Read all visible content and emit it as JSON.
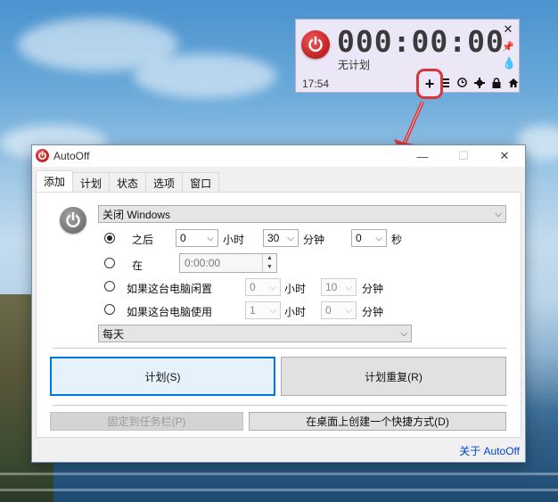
{
  "mini": {
    "countdown": "000:00:00",
    "plan_status": "无计划",
    "clock": "17:54",
    "side_icons": [
      "close-icon",
      "pin-icon",
      "drop-icon"
    ],
    "tool_icons": [
      "list-icon",
      "clock-icon",
      "gear-icon",
      "lock-icon",
      "home-icon"
    ],
    "add_label": "+"
  },
  "window": {
    "title": "AutoOff",
    "minimize": "—",
    "maximize": "☐",
    "close": "✕"
  },
  "tabs": [
    "添加",
    "计划",
    "状态",
    "选项",
    "窗口"
  ],
  "form": {
    "action": "关闭 Windows",
    "after_label": "之后",
    "after_hours": "0",
    "hours_unit": "小时",
    "after_minutes": "30",
    "minutes_unit": "分钟",
    "after_seconds": "0",
    "seconds_unit": "秒",
    "at_label": "在",
    "at_time": "0:00:00",
    "idle_label": "如果这台电脑闲置",
    "idle_hours": "0",
    "idle_minutes": "10",
    "use_label": "如果这台电脑使用",
    "use_hours": "1",
    "use_minutes": "0",
    "repeat": "每天"
  },
  "buttons": {
    "schedule": "计划(S)",
    "schedule_repeat": "计划重复(R)",
    "pin_taskbar": "固定到任务栏(P)",
    "desktop_shortcut": "在桌面上创建一个快捷方式(D)"
  },
  "about": "关于 AutoOff",
  "colors": {
    "accent": "#0078d7",
    "power_red": "#c11e1e",
    "highlight_ring": "#d9363a"
  }
}
